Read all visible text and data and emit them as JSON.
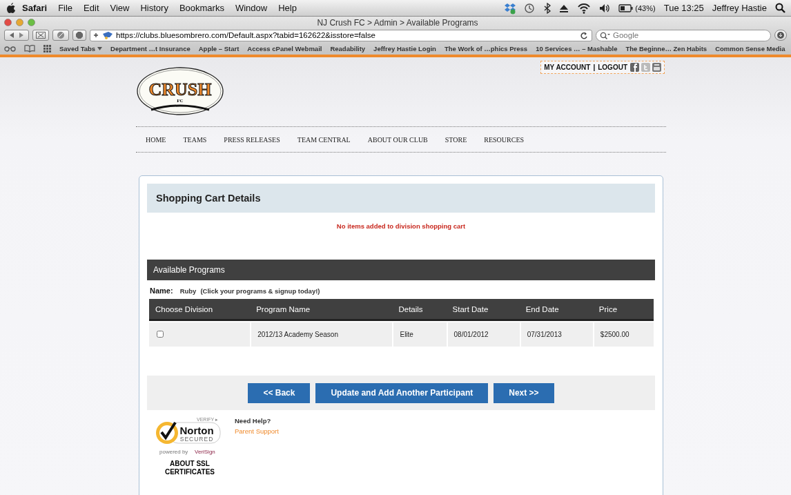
{
  "menubar": {
    "app": "Safari",
    "items": [
      "File",
      "Edit",
      "View",
      "History",
      "Bookmarks",
      "Window",
      "Help"
    ],
    "battery": "(43%)",
    "clock": "Tue 13:25",
    "user": "Jeffrey Hastie"
  },
  "browser": {
    "title": "NJ Crush FC > Admin > Available Programs",
    "url": "https://clubs.bluesombrero.com/Default.aspx?tabid=162622&isstore=false",
    "search": {
      "placeholder": "Google"
    }
  },
  "bookmarks": [
    "Saved Tabs",
    "Department …t Insurance",
    "Apple – Start",
    "Access cPanel Webmail",
    "Readability",
    "Jeffrey Hastie Login",
    "The Work of …phics Press",
    "10 Services … – Mashable",
    "The Beginne… Zen Habits",
    "Common Sense Media"
  ],
  "site": {
    "account_links": [
      "MY ACCOUNT",
      "LOGOUT"
    ],
    "account_separator": "|",
    "logo": {
      "name": "CRUSH",
      "sub": "FC"
    },
    "nav": [
      "HOME",
      "TEAMS",
      "PRESS RELEASES",
      "TEAM CENTRAL",
      "ABOUT OUR CLUB",
      "STORE",
      "RESOURCES"
    ],
    "cart": {
      "title": "Shopping Cart Details",
      "message": "No items added to division shopping cart"
    },
    "programs": {
      "title": "Available Programs",
      "name_label": "Name:",
      "name_value": "Ruby",
      "hint": "(Click your programs & signup today!)",
      "columns": [
        "Choose Division",
        "Program Name",
        "Details",
        "Start Date",
        "End Date",
        "Price"
      ],
      "rows": [
        {
          "checked": false,
          "cells": [
            "",
            "2012/13 Academy Season",
            "Elite",
            "08/01/2012",
            "07/31/2013",
            "$2500.00"
          ]
        }
      ]
    },
    "buttons": [
      "<< Back",
      "Update and Add Another Participant",
      "Next >>"
    ],
    "help": {
      "title": "Need Help?",
      "link": "Parent Support"
    },
    "seal": {
      "verify": "VERIFY ▸",
      "brand": "Norton",
      "status": "SECURED",
      "powered": "powered by",
      "vendor": "VeriSign",
      "about": "ABOUT SSL CERTIFICATES"
    }
  }
}
